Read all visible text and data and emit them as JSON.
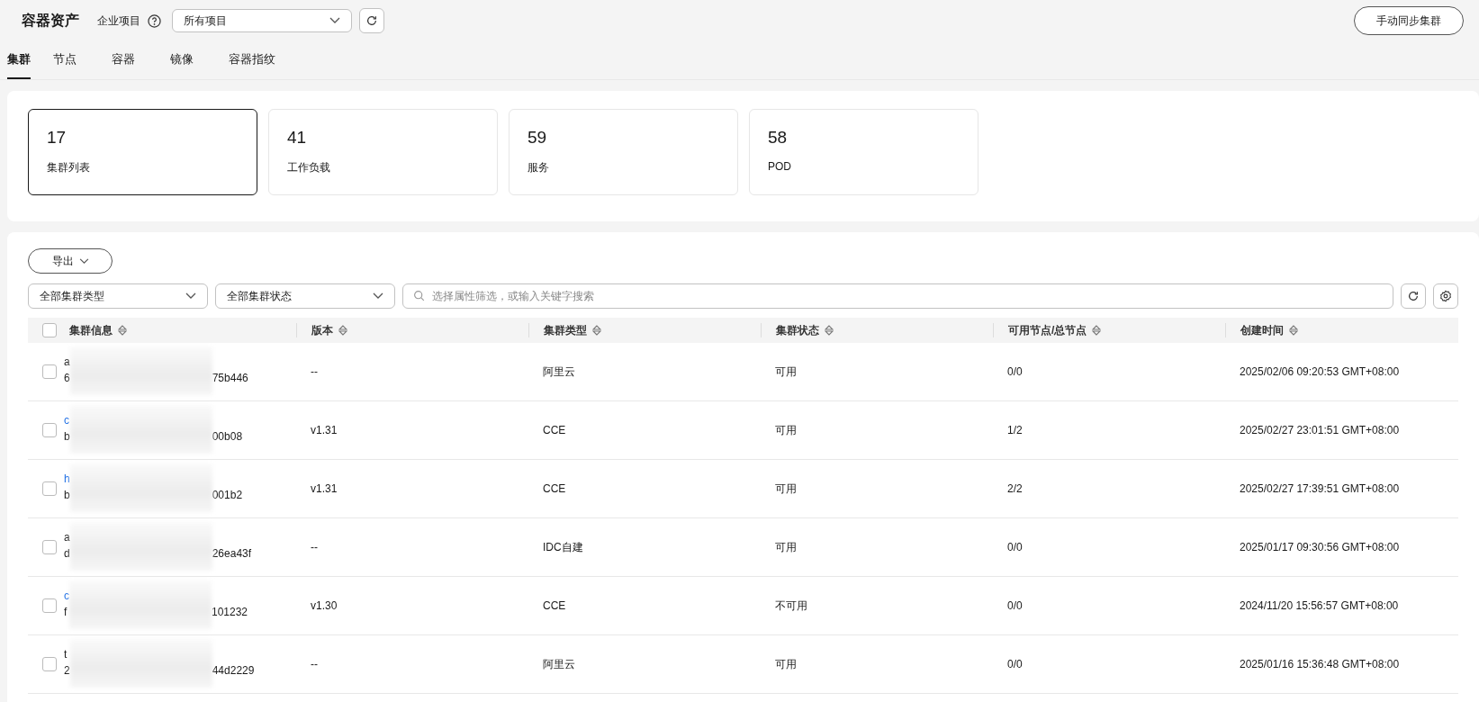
{
  "header": {
    "title": "容器资产",
    "project_label": "企业项目",
    "project_select": "所有项目",
    "sync_button": "手动同步集群"
  },
  "tabs": [
    {
      "label": "集群",
      "selected": true
    },
    {
      "label": "节点",
      "selected": false
    },
    {
      "label": "容器",
      "selected": false
    },
    {
      "label": "镜像",
      "selected": false
    },
    {
      "label": "容器指纹",
      "selected": false
    }
  ],
  "stat_cards": [
    {
      "value": "17",
      "label": "集群列表",
      "selected": true
    },
    {
      "value": "41",
      "label": "工作负载",
      "selected": false
    },
    {
      "value": "59",
      "label": "服务",
      "selected": false
    },
    {
      "value": "58",
      "label": "POD",
      "selected": false
    }
  ],
  "toolbar": {
    "export_button": "导出",
    "type_filter": "全部集群类型",
    "status_filter": "全部集群状态",
    "search_placeholder": "选择属性筛选，或输入关键字搜索"
  },
  "table": {
    "select_all_checked": false,
    "columns": [
      "集群信息",
      "版本",
      "集群类型",
      "集群状态",
      "可用节点/总节点",
      "创建时间"
    ],
    "rows": [
      {
        "checked": false,
        "name": "a",
        "linked": false,
        "id_start": "6",
        "id_end": "75b446",
        "version": "--",
        "type": "阿里云",
        "status": "可用",
        "nodes": "0/0",
        "created": "2025/02/06 09:20:53 GMT+08:00"
      },
      {
        "checked": false,
        "name": "c",
        "linked": true,
        "id_start": "b",
        "id_end": "00b08",
        "version": "v1.31",
        "type": "CCE",
        "status": "可用",
        "nodes": "1/2",
        "created": "2025/02/27 23:01:51 GMT+08:00"
      },
      {
        "checked": false,
        "name": "h",
        "linked": true,
        "id_start": "b",
        "id_end": "001b2",
        "version": "v1.31",
        "type": "CCE",
        "status": "可用",
        "nodes": "2/2",
        "created": "2025/02/27 17:39:51 GMT+08:00"
      },
      {
        "checked": false,
        "name": "a",
        "linked": false,
        "id_start": "d",
        "id_end": "26ea43f",
        "version": "--",
        "type": "IDC自建",
        "status": "可用",
        "nodes": "0/0",
        "created": "2025/01/17 09:30:56 GMT+08:00"
      },
      {
        "checked": false,
        "name": "c",
        "linked": true,
        "id_start": "f",
        "id_end": "101232",
        "version": "v1.30",
        "type": "CCE",
        "status": "不可用",
        "nodes": "0/0",
        "created": "2024/11/20 15:56:57 GMT+08:00"
      },
      {
        "checked": false,
        "name": "t",
        "linked": false,
        "id_start": "2",
        "id_end": "44d2229",
        "version": "--",
        "type": "阿里云",
        "status": "可用",
        "nodes": "0/0",
        "created": "2025/01/16 15:36:48 GMT+08:00"
      }
    ]
  }
}
